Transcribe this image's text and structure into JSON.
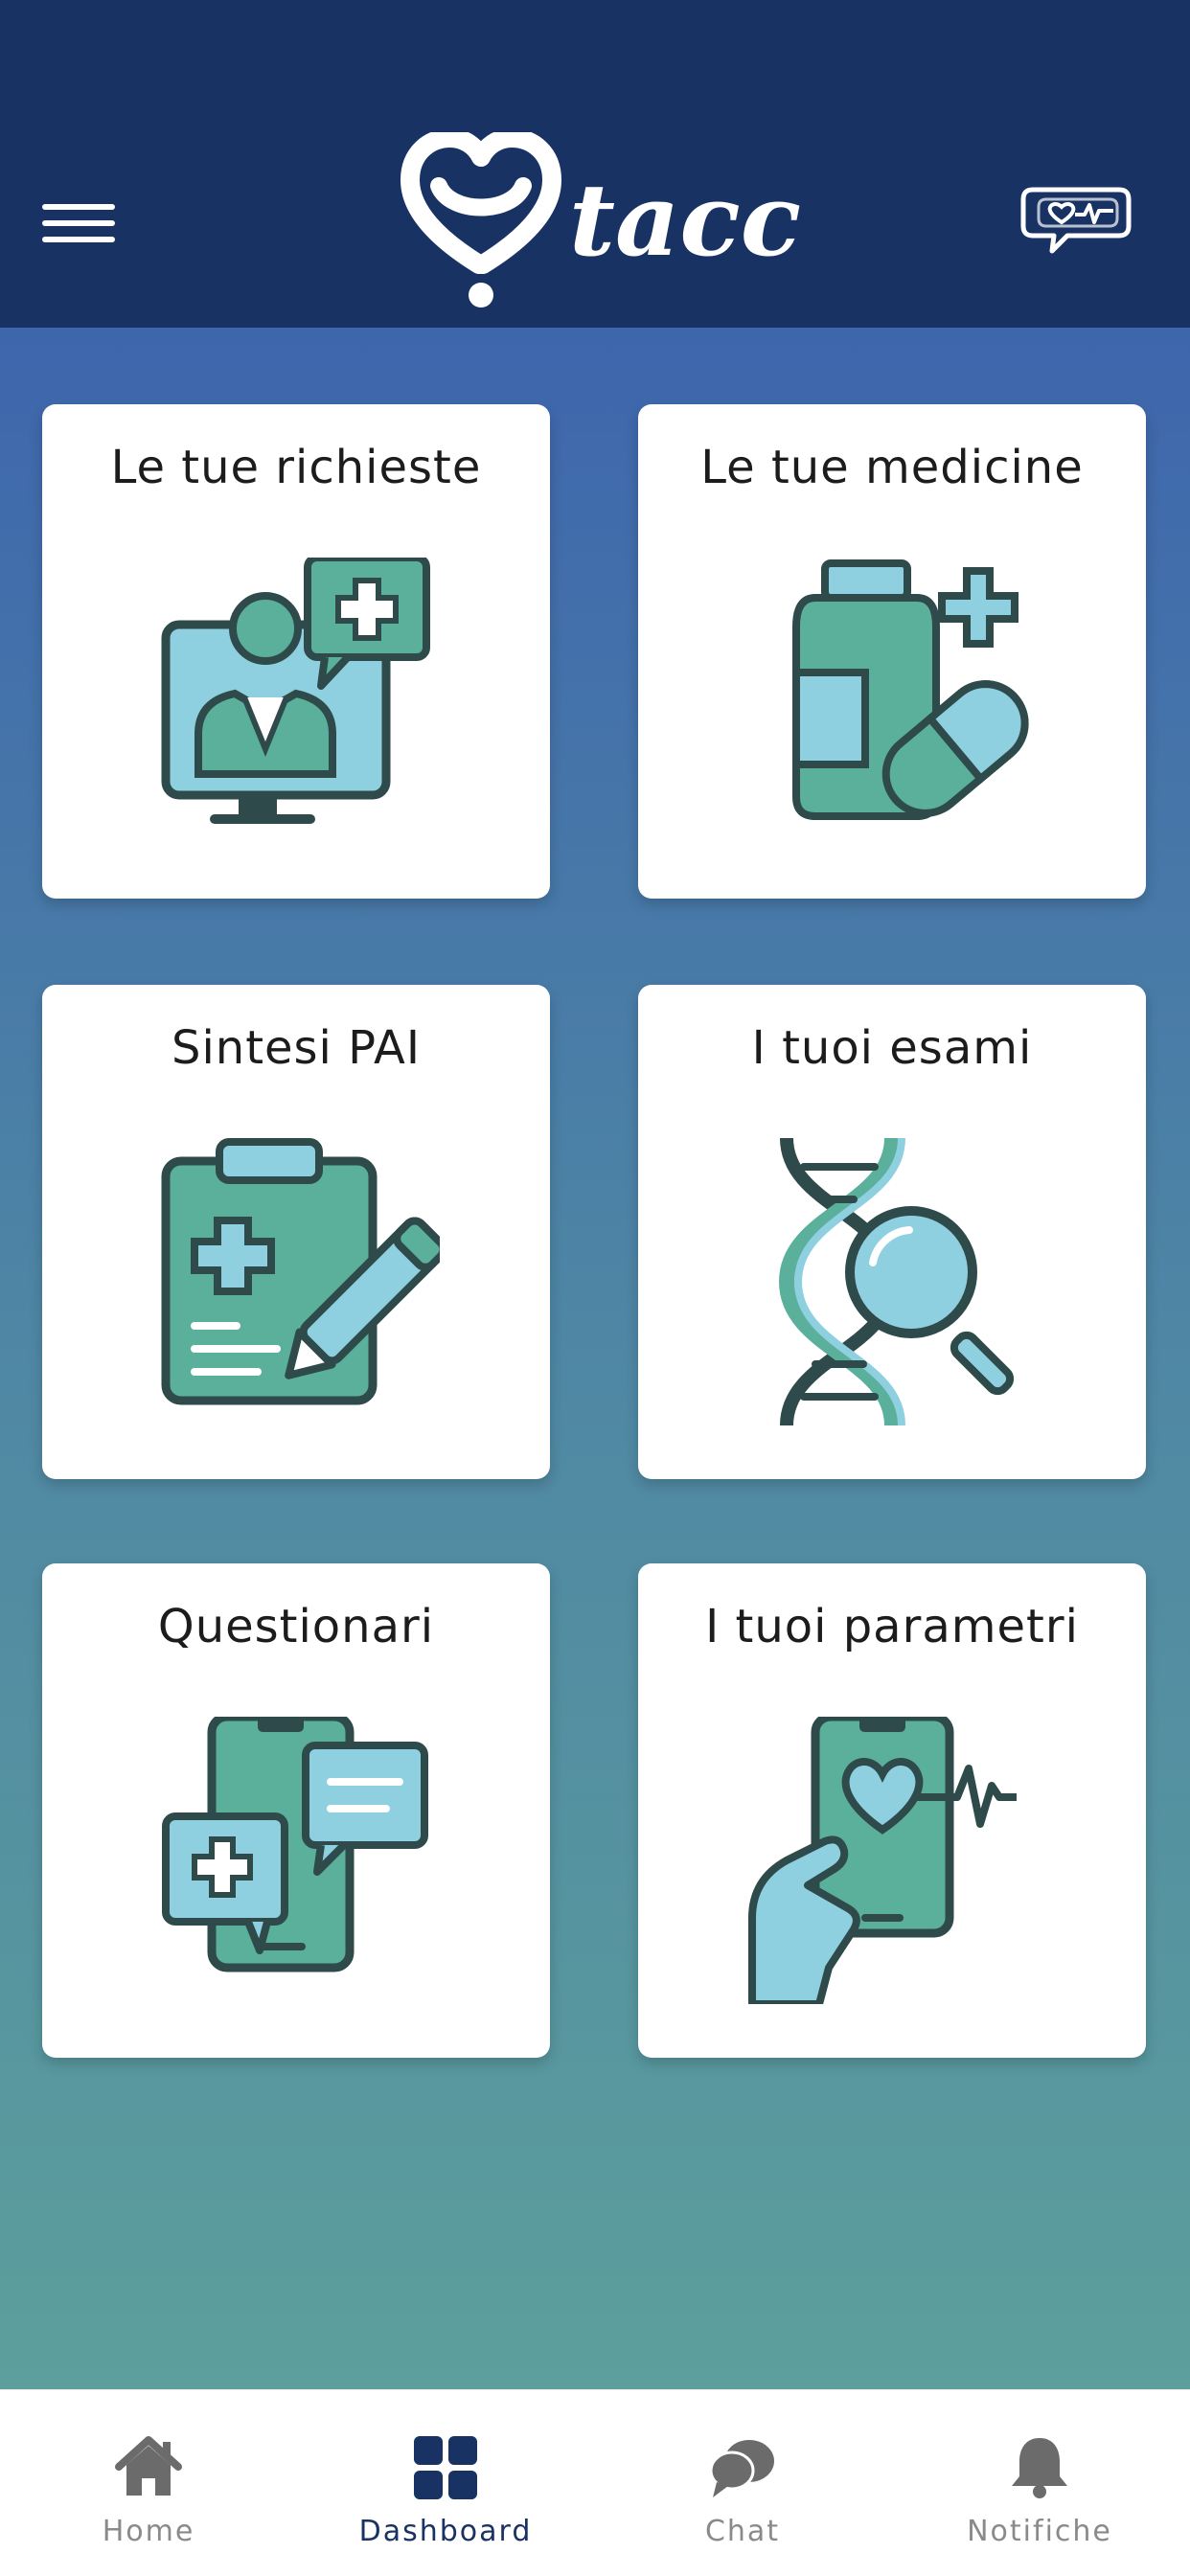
{
  "header": {
    "brand": "tacc",
    "menu_icon": "hamburger-menu-icon",
    "right_icon": "heart-chat-icon"
  },
  "cards": [
    {
      "title": "Le tue richieste",
      "icon": "doctor-monitor-icon"
    },
    {
      "title": "Le tue medicine",
      "icon": "medicine-bottle-pill-icon"
    },
    {
      "title": "Sintesi PAI",
      "icon": "clipboard-pencil-icon"
    },
    {
      "title": "I tuoi esami",
      "icon": "dna-magnifier-icon"
    },
    {
      "title": "Questionari",
      "icon": "phone-chat-bubbles-icon"
    },
    {
      "title": "I tuoi parametri",
      "icon": "phone-heartbeat-icon"
    }
  ],
  "tabs": [
    {
      "label": "Home",
      "icon": "home-icon",
      "active": false
    },
    {
      "label": "Dashboard",
      "icon": "dashboard-grid-icon",
      "active": true
    },
    {
      "label": "Chat",
      "icon": "chat-icon",
      "active": false
    },
    {
      "label": "Notifiche",
      "icon": "bell-icon",
      "active": false
    }
  ],
  "colors": {
    "header_bg": "#183263",
    "gradient_top": "#3e66ad",
    "gradient_bottom": "#5c9f9c",
    "icon_teal": "#5bb09c",
    "icon_blue": "#8ecfe0",
    "icon_outline": "#2f4a4a"
  }
}
